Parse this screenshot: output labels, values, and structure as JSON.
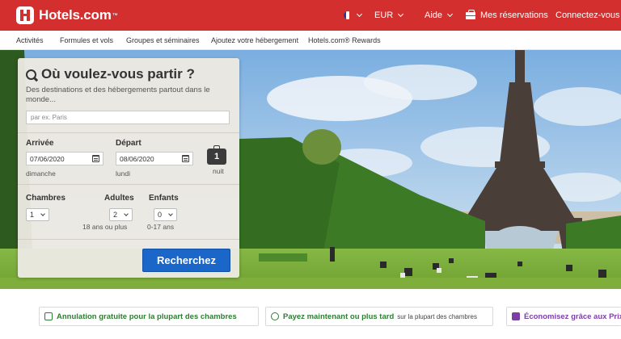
{
  "header": {
    "logo_text": "Hotels.com",
    "logo_tm": "™",
    "currency": "EUR",
    "help": "Aide",
    "reservations": "Mes réservations",
    "login": "Connectez-vous",
    "flag_colors": [
      "#1f3d99",
      "#ffffff",
      "#d32f2f"
    ]
  },
  "subnav": {
    "items": [
      "Activités",
      "Formules et vols",
      "Groupes et séminaires",
      "Ajoutez votre hébergement",
      "Hotels.com® Rewards"
    ]
  },
  "search": {
    "title": "Où voulez-vous partir ?",
    "subtitle": "Des destinations et des hébergements partout dans le monde...",
    "destination_placeholder": "par ex. Paris",
    "arrival_label": "Arrivée",
    "arrival_date": "07/06/2020",
    "arrival_weekday": "dimanche",
    "departure_label": "Départ",
    "departure_date": "08/06/2020",
    "departure_weekday": "lundi",
    "nights_count": "1",
    "nights_label": "nuit",
    "rooms_label": "Chambres",
    "rooms_value": "1",
    "adults_label": "Adultes",
    "adults_value": "2",
    "adults_hint": "18 ans ou plus",
    "children_label": "Enfants",
    "children_value": "0",
    "children_hint": "0-17 ans",
    "button_label": "Recherchez"
  },
  "benefits": [
    {
      "strong": "Annulation gratuite pour la plupart des chambres",
      "light": ""
    },
    {
      "strong": "Payez maintenant ou plus tard",
      "light": "sur la plupart des chambres"
    },
    {
      "strong": "Économisez grâce aux Prix",
      "light": ""
    }
  ],
  "colors": {
    "brand_red": "#d32f2f",
    "button_blue": "#1b66c9",
    "benefit_green": "#2e7d32",
    "benefit_purple": "#7b3fa6"
  }
}
